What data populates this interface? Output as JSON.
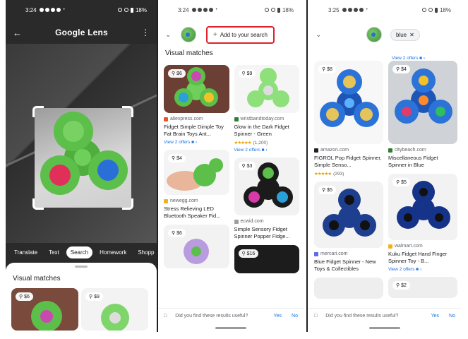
{
  "panel1": {
    "time": "3:24",
    "battery": "18%",
    "title": "Google Lens",
    "modes": [
      "Translate",
      "Text",
      "Search",
      "Homework",
      "Shopp"
    ],
    "active_mode": "Search",
    "section_title": "Visual matches",
    "thumbs": [
      {
        "price": "$6"
      },
      {
        "price": "$9"
      }
    ]
  },
  "panel2": {
    "time": "3:24",
    "battery": "18%",
    "add_search_label": "Add to your search",
    "section_title": "Visual matches",
    "left": [
      {
        "price": "$6",
        "site": "aliexpress.com",
        "title": "Fidget Simple Dimple Toy Fat Brain Toys Ant...",
        "offers": "View 2 offers"
      },
      {
        "price": "$4",
        "site": "newegg.com",
        "title": "Stress Relieving LED Bluetooth Speaker Fid..."
      },
      {
        "price": "$6"
      }
    ],
    "right": [
      {
        "price": "$9",
        "site": "wristbandtoday.com",
        "title": "Glow in the Dark Fidget Spinner - Green",
        "rating": "(1,200)",
        "offers": "View 2 offers"
      },
      {
        "price": "$3",
        "site": "ecwid.com",
        "title": "Simple Sensory Fidget Spinner Popper Fidge..."
      },
      {
        "price": "$16"
      }
    ],
    "feedback_question": "Did you find these results useful?",
    "yes": "Yes",
    "no": "No"
  },
  "panel3": {
    "time": "3:25",
    "battery": "18%",
    "chip_label": "blue",
    "top_offers": "View 2 offers",
    "left": [
      {
        "price": "$8",
        "site": "amazon.com",
        "title": "FIGROL Pop Fidget Spinner, Simple Senso...",
        "rating": "(293)"
      },
      {
        "price": "$5",
        "site": "mercari.com",
        "title": "Blue Fidget Spinner - New Toys & Collectibles"
      },
      {}
    ],
    "right": [
      {
        "price": "$4",
        "site": "citybeach.com",
        "title": "Miscellaneous Fidget Spinner in Blue"
      },
      {
        "price": "$5",
        "site": "walmart.com",
        "title": "Kuku Fidget Hand Finger Spinner Toy - B...",
        "offers": "View 2 offers"
      },
      {
        "price": "$2"
      }
    ],
    "feedback_question": "Did you find these results useful?",
    "yes": "Yes",
    "no": "No"
  },
  "colors": {
    "highlight_red": "#e0202a",
    "link_blue": "#1a73e8",
    "spinner_green": "#5cbf4a",
    "spinner_blue": "#1e56b8"
  }
}
